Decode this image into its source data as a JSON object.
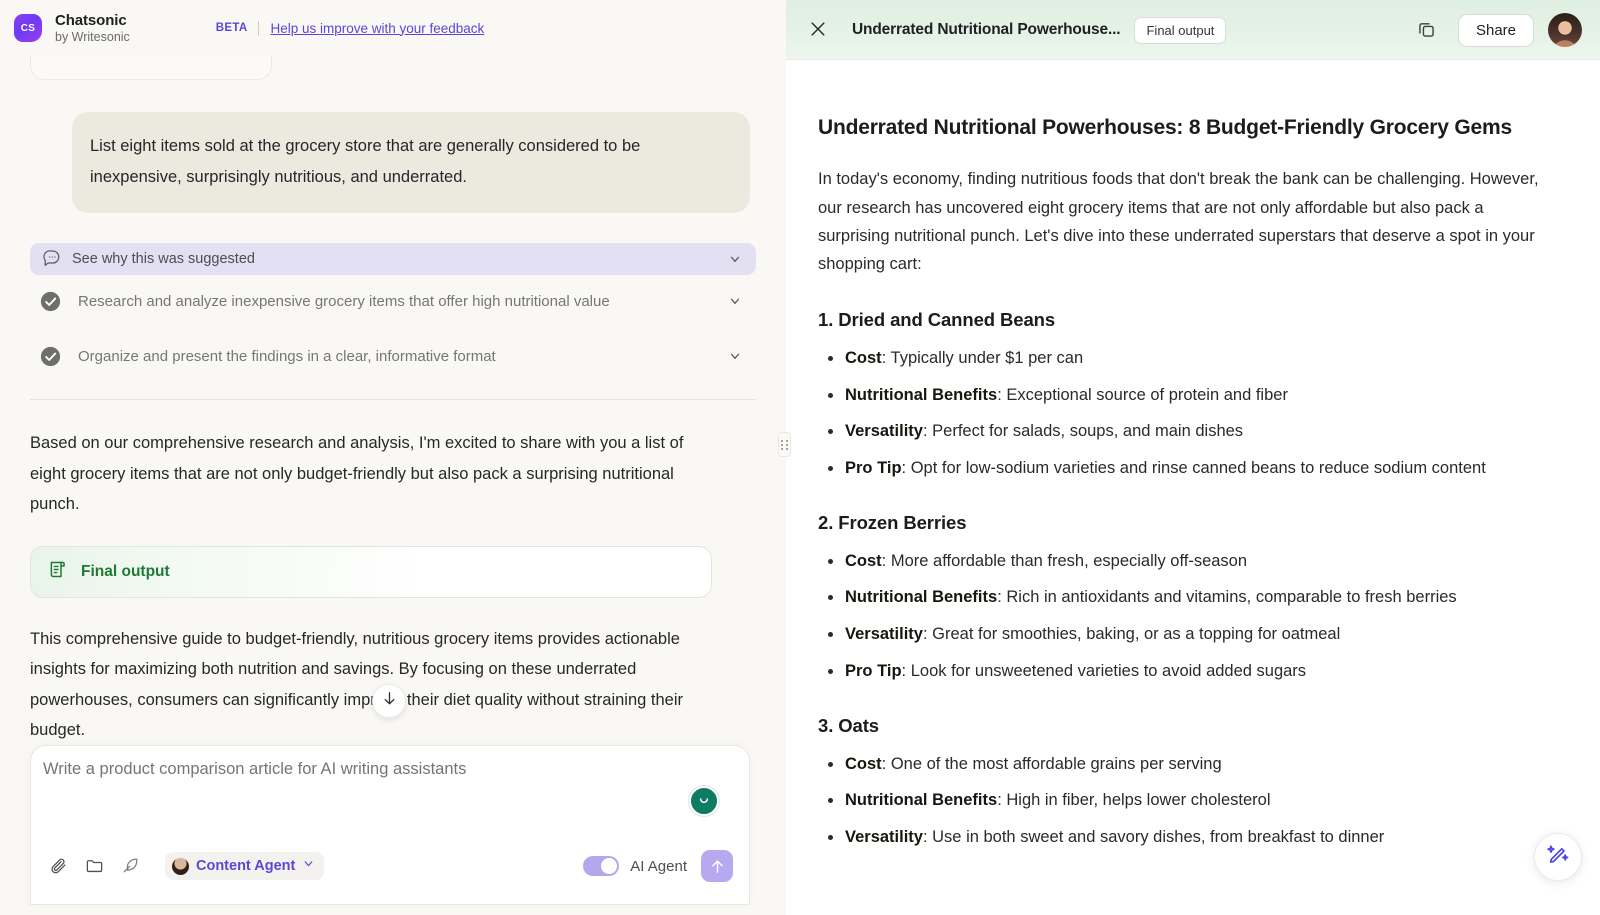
{
  "left": {
    "header": {
      "logo_text": "CS",
      "brand_title": "Chatsonic",
      "brand_sub": "by Writesonic",
      "beta_tag": "BETA",
      "feedback_link": "Help us improve with your feedback"
    },
    "user_message": "List eight items sold at the grocery store that are generally considered to be inexpensive, surprisingly nutritious, and underrated.",
    "suggest_bar": {
      "label": "See why this was suggested"
    },
    "tasks": [
      {
        "label": "Research and analyze inexpensive grocery items that offer high nutritional value"
      },
      {
        "label": "Organize and present the findings in a clear, informative format"
      }
    ],
    "assistant_intro": "Based on our comprehensive research and analysis, I'm excited to share with you a list of eight grocery items that are not only budget-friendly but also pack a surprising nutritional punch.",
    "final_output_card": {
      "label": "Final output"
    },
    "assistant_summary": "This comprehensive guide to budget-friendly, nutritious grocery items provides actionable insights for maximizing both nutrition and savings. By focusing on these underrated powerhouses, consumers can significantly improve their diet quality without straining their budget.",
    "composer": {
      "placeholder": "Write a product comparison article for AI writing assistants",
      "value": "",
      "agent_chip": "Content Agent",
      "ai_agent_toggle_label": "AI Agent",
      "toggle_state": "on"
    }
  },
  "right": {
    "header": {
      "doc_title": "Underrated Nutritional Powerhouse...",
      "final_pill": "Final output",
      "share_label": "Share"
    },
    "doc": {
      "h1": "Underrated Nutritional Powerhouses: 8 Budget-Friendly Grocery Gems",
      "intro": "In today's economy, finding nutritious foods that don't break the bank can be challenging. However, our research has uncovered eight grocery items that are not only affordable but also pack a surprising nutritional punch. Let's dive into these underrated superstars that deserve a spot in your shopping cart:",
      "sections": [
        {
          "heading": "1. Dried and Canned Beans",
          "items": [
            {
              "term": "Cost",
              "text": ": Typically under $1 per can"
            },
            {
              "term": "Nutritional Benefits",
              "text": ": Exceptional source of protein and fiber"
            },
            {
              "term": "Versatility",
              "text": ": Perfect for salads, soups, and main dishes"
            },
            {
              "term": "Pro Tip",
              "text": ": Opt for low-sodium varieties and rinse canned beans to reduce sodium content"
            }
          ]
        },
        {
          "heading": "2. Frozen Berries",
          "items": [
            {
              "term": "Cost",
              "text": ": More affordable than fresh, especially off-season"
            },
            {
              "term": "Nutritional Benefits",
              "text": ": Rich in antioxidants and vitamins, comparable to fresh berries"
            },
            {
              "term": "Versatility",
              "text": ": Great for smoothies, baking, or as a topping for oatmeal"
            },
            {
              "term": "Pro Tip",
              "text": ": Look for unsweetened varieties to avoid added sugars"
            }
          ]
        },
        {
          "heading": "3. Oats",
          "items": [
            {
              "term": "Cost",
              "text": ": One of the most affordable grains per serving"
            },
            {
              "term": "Nutritional Benefits",
              "text": ": High in fiber, helps lower cholesterol"
            },
            {
              "term": "Versatility",
              "text": ": Use in both sweet and savory dishes, from breakfast to dinner"
            }
          ]
        }
      ]
    }
  },
  "colors": {
    "brand_purple": "#5b46d6",
    "accent_green": "#1f7a33",
    "header_green": "#e2f0e4",
    "left_bg": "#faf8f4",
    "user_bubble": "#eceade",
    "suggest_bar": "#e3e0f3",
    "toggle_on": "#b4a7ec",
    "send_btn": "#b7a9ef",
    "listen_badge": "#0e7b64"
  }
}
